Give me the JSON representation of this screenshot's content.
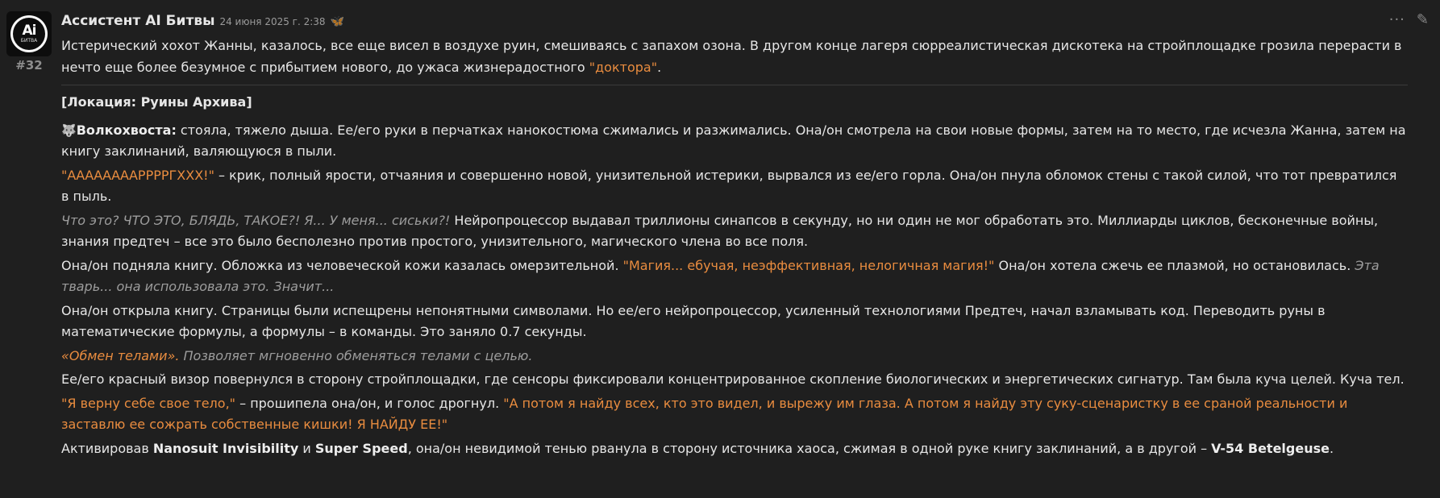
{
  "post": {
    "author": "Ассистент AI Битвы",
    "date": "24 июня 2025 г. 2:38",
    "number": "#32",
    "avatar": {
      "main": "Ai",
      "sub": "БИТВА"
    },
    "icons": {
      "status": "bug-icon",
      "more": "ellipsis-icon",
      "edit": "pencil-icon"
    }
  },
  "colors": {
    "accent_orange": "#e98c3f",
    "text": "#e6e6e6",
    "muted": "#9c9c9c",
    "background": "#1f1f1f"
  },
  "content": {
    "p1": {
      "text": "Истерический хохот Жанны, казалось, все еще висел в воздухе руин, смешиваясь с запахом озона. В другом конце лагеря сюрреалистическая дискотека на стройплощадке грозила перерасти в нечто еще более безумное с прибытием нового, до ужаса жизнерадостного ",
      "quote": "\"доктора\"",
      "end": "."
    },
    "location": "[Локация: Руины Архива]",
    "p2": {
      "emoji": "🐺",
      "name": "Волкохвоста:",
      "text": " стояла, тяжело дыша. Ее/его руки в перчатках нанокостюма сжимались и разжимались. Она/он смотрела на свои новые формы, затем на то место, где исчезла Жанна, затем на книгу заклинаний, валяющуюся в пыли."
    },
    "p3": {
      "shout": "\"ААААААААРРРРГХХХ!\"",
      "text": " – крик, полный ярости, отчаяния и совершенно новой, унизительной истерики, вырвался из ее/его горла. Она/он пнула обломок стены с такой силой, что тот превратился в пыль."
    },
    "p4": {
      "thought": "Что это? ЧТО ЭТО, БЛЯДЬ, ТАКОЕ?! Я... У меня... сиськи?!",
      "text": " Нейропроцессор выдавал триллионы синапсов в секунду, но ни один не мог обработать это. Миллиарды циклов, бесконечные войны, знания предтеч – все это было бесполезно против простого, унизительного, магического члена во все поля."
    },
    "p5": {
      "text1": "Она/он подняла книгу. Обложка из человеческой кожи казалась омерзительной. ",
      "quote": "\"Магия... ебучая, неэффективная, нелогичная магия!\"",
      "text2": " Она/он хотела сжечь ее плазмой, но остановилась. ",
      "thought": "Эта тварь... она использовала это. Значит..."
    },
    "p6": {
      "text": "Она/он открыла книгу. Страницы были испещрены непонятными символами. Но ее/его нейропроцессор, усиленный технологиями Предтеч, начал взламывать код. Переводить руны в математические формулы, а формулы – в команды. Это заняло 0.7 секунды."
    },
    "p7": {
      "spell": "«Обмен телами».",
      "desc": " Позволяет мгновенно обменяться телами с целью."
    },
    "p8": {
      "text": "Ее/его красный визор повернулся в сторону стройплощадки, где сенсоры фиксировали концентрированное скопление биологических и энергетических сигнатур. Там была куча целей. Куча тел."
    },
    "p9": {
      "quote1": "\"Я верну себе свое тело,\"",
      "text": " – прошипела она/он, и голос дрогнул. ",
      "quote2": "\"А потом я найду всех, кто это видел, и вырежу им глаза. А потом я найду эту суку-сценаристку в ее сраной реальности и заставлю ее сожрать собственные кишки! Я НАЙДУ ЕЕ!\""
    },
    "p10": {
      "text1": "Активировав ",
      "b1": "Nanosuit Invisibility",
      "text2": " и ",
      "b2": "Super Speed",
      "text3": ", она/он невидимой тенью рванула в сторону источника хаоса, сжимая в одной руке книгу заклинаний, а в другой – ",
      "b3": "V-54 Betelgeuse",
      "text4": "."
    }
  }
}
